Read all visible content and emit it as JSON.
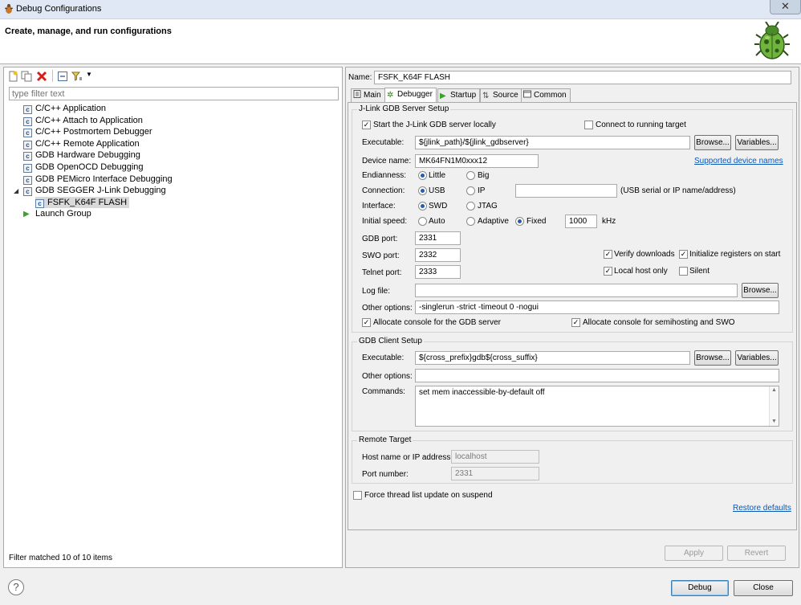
{
  "window": {
    "title": "Debug Configurations",
    "close_glyph": "✕"
  },
  "header": {
    "heading": "Create, manage, and run configurations"
  },
  "left": {
    "filter_placeholder": "type filter text",
    "tree": [
      {
        "label": "C/C++ Application",
        "icon": "c-config-icon"
      },
      {
        "label": "C/C++ Attach to Application",
        "icon": "c-config-icon"
      },
      {
        "label": "C/C++ Postmortem Debugger",
        "icon": "c-config-icon"
      },
      {
        "label": "C/C++ Remote Application",
        "icon": "c-config-icon"
      },
      {
        "label": "GDB Hardware Debugging",
        "icon": "c-config-icon"
      },
      {
        "label": "GDB OpenOCD Debugging",
        "icon": "c-config-icon"
      },
      {
        "label": "GDB PEMicro Interface Debugging",
        "icon": "c-config-icon"
      },
      {
        "label": "GDB SEGGER J-Link Debugging",
        "icon": "c-config-icon",
        "expanded": true
      },
      {
        "label": "FSFK_K64F FLASH",
        "icon": "c-config-icon",
        "selected": true
      },
      {
        "label": "Launch Group",
        "icon": "launch-icon"
      }
    ],
    "status": "Filter matched 10 of 10 items"
  },
  "right": {
    "name_label": "Name:",
    "name_value": "FSFK_K64F FLASH",
    "tabs": [
      "Main",
      "Debugger",
      "Startup",
      "Source",
      "Common"
    ],
    "active_tab": "Debugger",
    "server": {
      "title": "J-Link GDB Server Setup",
      "start_locally": "Start the J-Link GDB server locally",
      "connect_running": "Connect to running target",
      "exe_label": "Executable:",
      "exe_value": "${jlink_path}/${jlink_gdbserver}",
      "browse": "Browse...",
      "variables": "Variables...",
      "device_label": "Device name:",
      "device_value": "MK64FN1M0xxx12",
      "supported_link": "Supported device names",
      "endian_label": "Endianness:",
      "endian_little": "Little",
      "endian_big": "Big",
      "conn_label": "Connection:",
      "conn_usb": "USB",
      "conn_ip": "IP",
      "conn_hint": "(USB serial or IP name/address)",
      "iface_label": "Interface:",
      "iface_swd": "SWD",
      "iface_jtag": "JTAG",
      "speed_label": "Initial speed:",
      "speed_auto": "Auto",
      "speed_adaptive": "Adaptive",
      "speed_fixed": "Fixed",
      "speed_value": "1000",
      "speed_unit": "kHz",
      "gdbport_label": "GDB port:",
      "gdbport_value": "2331",
      "swoport_label": "SWO port:",
      "swoport_value": "2332",
      "telnet_label": "Telnet port:",
      "telnet_value": "2333",
      "verify": "Verify downloads",
      "init_regs": "Initialize registers on start",
      "local_only": "Local host only",
      "silent": "Silent",
      "log_label": "Log file:",
      "log_value": "",
      "other_label": "Other options:",
      "other_value": "-singlerun -strict -timeout 0 -nogui",
      "alloc_gdb": "Allocate console for the GDB server",
      "alloc_semi": "Allocate console for semihosting and SWO"
    },
    "client": {
      "title": "GDB Client Setup",
      "exe_label": "Executable:",
      "exe_value": "${cross_prefix}gdb${cross_suffix}",
      "other_label": "Other options:",
      "other_value": "",
      "cmd_label": "Commands:",
      "cmd_value": "set mem inaccessible-by-default off"
    },
    "remote": {
      "title": "Remote Target",
      "host_label": "Host name or IP address:",
      "host_value": "localhost",
      "port_label": "Port number:",
      "port_value": "2331"
    },
    "force_thread": "Force thread list update on suspend",
    "restore": "Restore defaults",
    "apply": "Apply",
    "revert": "Revert"
  },
  "footer": {
    "help": "?",
    "debug": "Debug",
    "close": "Close"
  }
}
